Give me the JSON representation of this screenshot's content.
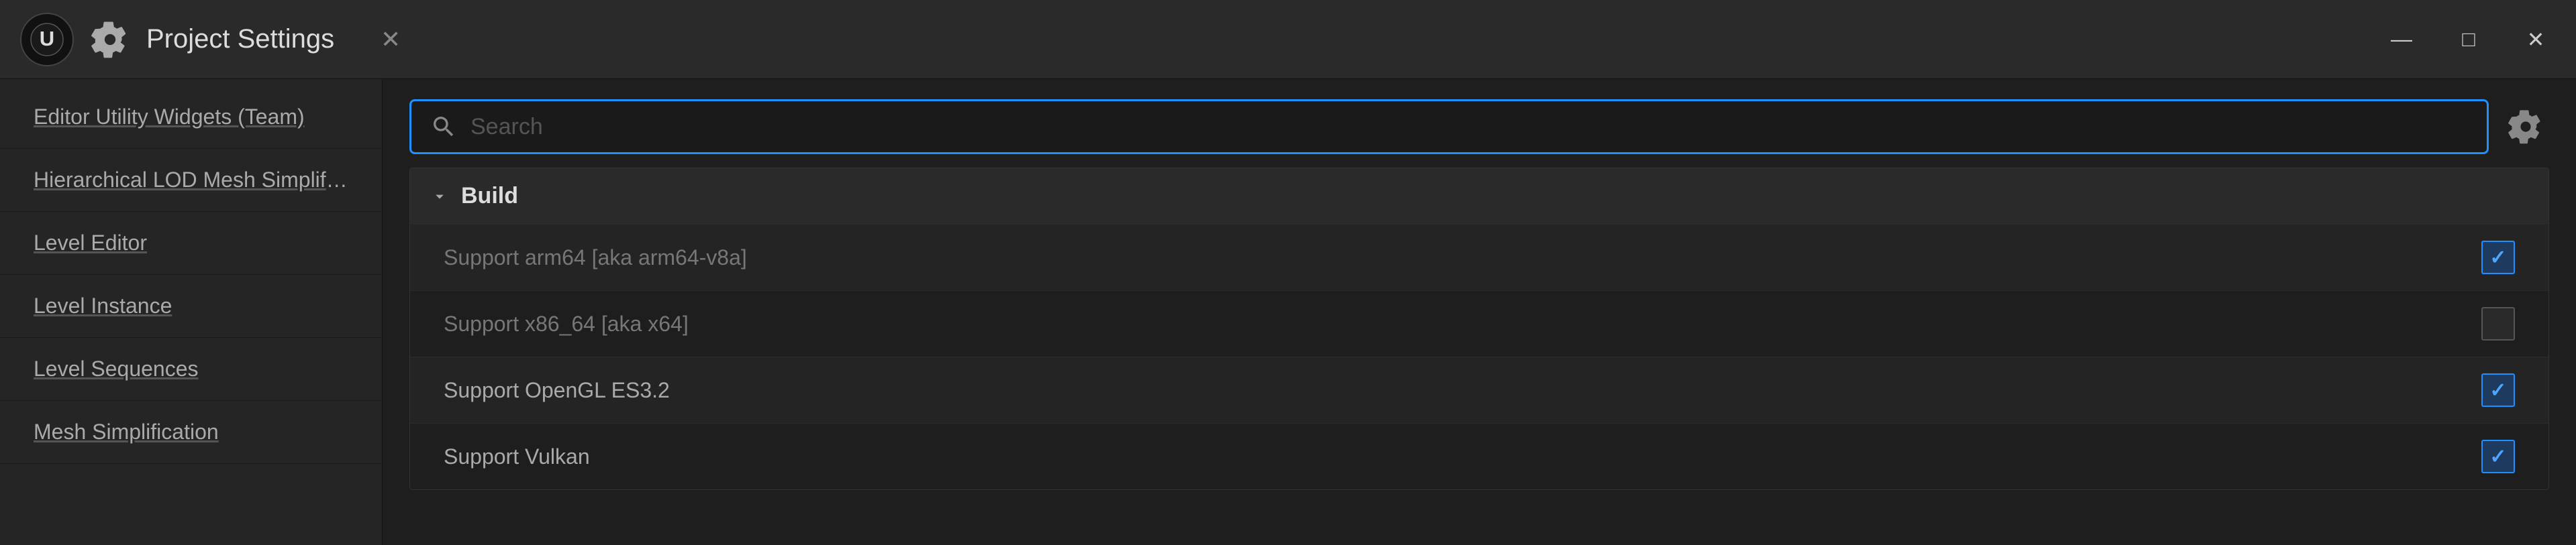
{
  "window": {
    "title": "Project Settings",
    "controls": {
      "minimize_label": "—",
      "maximize_label": "□",
      "close_label": "✕"
    }
  },
  "sidebar": {
    "items": [
      {
        "id": "editor-utility-widgets",
        "label": "Editor Utility Widgets (Team)"
      },
      {
        "id": "hierarchical-lod",
        "label": "Hierarchical LOD Mesh Simplification"
      },
      {
        "id": "level-editor",
        "label": "Level Editor"
      },
      {
        "id": "level-instance",
        "label": "Level Instance"
      },
      {
        "id": "level-sequences",
        "label": "Level Sequences"
      },
      {
        "id": "mesh-simplification",
        "label": "Mesh Simplification"
      }
    ]
  },
  "search": {
    "placeholder": "Search",
    "value": "",
    "gear_icon": "settings"
  },
  "sections": [
    {
      "id": "build",
      "title": "Build",
      "expanded": true,
      "settings": [
        {
          "id": "support-arm64",
          "label": "Support arm64 [aka arm64-v8a]",
          "checked": true,
          "dimmed": true
        },
        {
          "id": "support-x86_64",
          "label": "Support x86_64 [aka x64]",
          "checked": false,
          "dimmed": true
        },
        {
          "id": "support-opengl-es32",
          "label": "Support OpenGL ES3.2",
          "checked": true,
          "dimmed": false
        },
        {
          "id": "support-vulkan",
          "label": "Support Vulkan",
          "checked": true,
          "dimmed": false
        }
      ]
    }
  ]
}
